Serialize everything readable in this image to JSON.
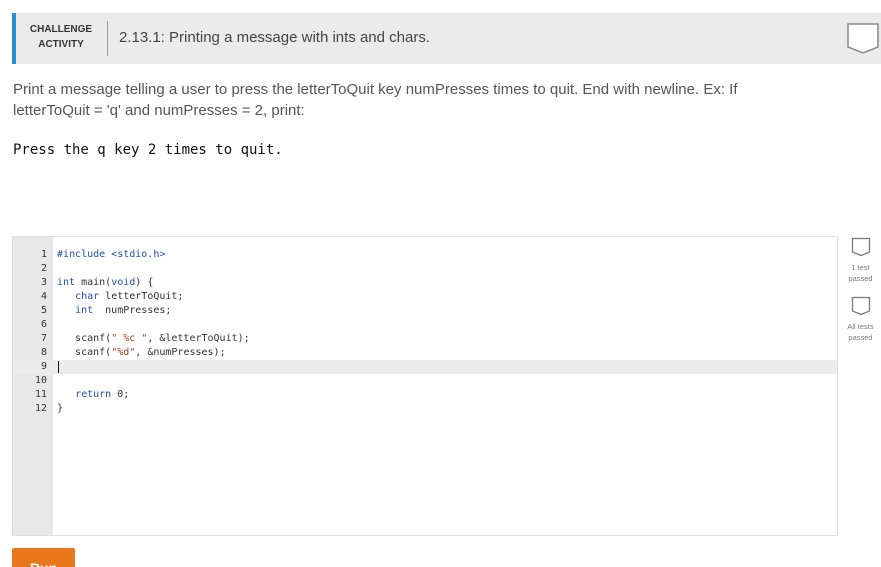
{
  "header": {
    "badge_line1": "CHALLENGE",
    "badge_line2": "ACTIVITY",
    "title": "2.13.1: Printing a message with ints and chars."
  },
  "instructions": {
    "line1": "Print a message telling a user to press the letterToQuit key numPresses times to quit. End with newline. Ex: If",
    "line2": "letterToQuit = 'q' and numPresses = 2, print:",
    "example": "Press the q key 2 times to quit."
  },
  "editor": {
    "active_line": 9,
    "lines": [
      {
        "no": "1",
        "parts": [
          {
            "t": "#include <stdio.h>",
            "c": "kw"
          }
        ]
      },
      {
        "no": "2",
        "parts": []
      },
      {
        "no": "3",
        "parts": [
          {
            "t": "int",
            "c": "kw"
          },
          {
            "t": " main("
          },
          {
            "t": "void",
            "c": "kw"
          },
          {
            "t": ") {"
          }
        ]
      },
      {
        "no": "4",
        "parts": [
          {
            "t": "   "
          },
          {
            "t": "char",
            "c": "kw"
          },
          {
            "t": " letterToQuit;"
          }
        ]
      },
      {
        "no": "5",
        "parts": [
          {
            "t": "   "
          },
          {
            "t": "int",
            "c": "kw"
          },
          {
            "t": "  numPresses;"
          }
        ]
      },
      {
        "no": "6",
        "parts": []
      },
      {
        "no": "7",
        "parts": [
          {
            "t": "   scanf("
          },
          {
            "t": "\" %c \"",
            "c": "str"
          },
          {
            "t": ", &letterToQuit);"
          }
        ]
      },
      {
        "no": "8",
        "parts": [
          {
            "t": "   scanf("
          },
          {
            "t": "\"%d\"",
            "c": "str"
          },
          {
            "t": ", &numPresses);"
          }
        ]
      },
      {
        "no": "9",
        "parts": []
      },
      {
        "no": "10",
        "parts": []
      },
      {
        "no": "11",
        "parts": [
          {
            "t": "   "
          },
          {
            "t": "return",
            "c": "kw"
          },
          {
            "t": " 0;"
          }
        ]
      },
      {
        "no": "12",
        "parts": [
          {
            "t": "}"
          }
        ]
      }
    ]
  },
  "tests": {
    "test1_line1": "1 test",
    "test1_line2": "passed",
    "test2_line1": "All tests",
    "test2_line2": "passed"
  },
  "run_button": {
    "label": "Run"
  },
  "colors": {
    "accent_blue": "#2a8fcc",
    "run_orange": "#e8771e",
    "keyword_blue": "#1f4fb4",
    "string_red": "#a1402a"
  }
}
